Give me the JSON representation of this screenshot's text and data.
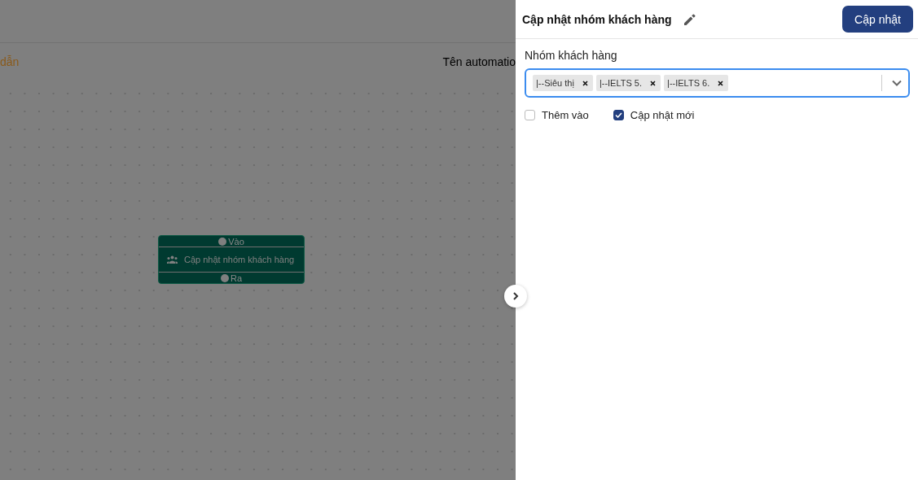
{
  "canvas": {
    "guide_link": "dẫn",
    "name_label": "Tên automatio",
    "node": {
      "input_port": "Vào",
      "title": "Cập nhật nhóm khách hàng",
      "output_port": "Ra"
    }
  },
  "panel": {
    "title": "Cập nhật nhóm khách hàng",
    "save_button": "Cập nhật",
    "field_label": "Nhóm khách hàng",
    "tags": [
      {
        "label": "|--Siêu thị"
      },
      {
        "label": "|--IELTS 5."
      },
      {
        "label": "|--IELTS 6."
      }
    ],
    "checkboxes": [
      {
        "label": "Thêm vào",
        "checked": false
      },
      {
        "label": "Cập nhật mới",
        "checked": true
      }
    ]
  }
}
